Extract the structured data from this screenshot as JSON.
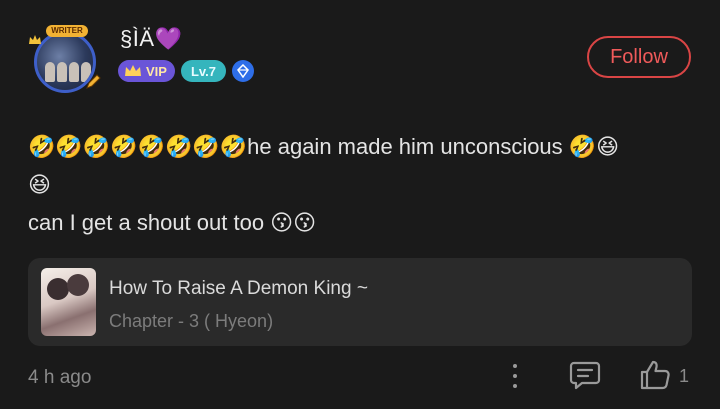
{
  "user": {
    "name": "§ÌÄ",
    "name_heart": "💜",
    "frame_badge": "WRITER",
    "vip_label": "VIP",
    "level_label": "Lv.7"
  },
  "follow_label": "Follow",
  "comment": {
    "line1_emojis": "🤣🤣🤣🤣🤣🤣🤣🤣",
    "line1_text": "he again made him unconscious 🤣😆",
    "line2": "😆",
    "line3": "can I get a shout out too 😗😗"
  },
  "book": {
    "title": "How To Raise A Demon King ~",
    "chapter": "Chapter - 3 ( Hyeon)"
  },
  "footer": {
    "time": "4 h ago",
    "like_count": "1"
  },
  "icons": {
    "more": "more-vertical-icon",
    "reply": "comment-icon",
    "like": "thumbs-up-icon"
  },
  "colors": {
    "background": "#1a1a1a",
    "follow_red": "#d94545",
    "vip_purple": "#6a55d8",
    "level_teal": "#35b5bd",
    "gem_blue": "#2e6ee8"
  }
}
